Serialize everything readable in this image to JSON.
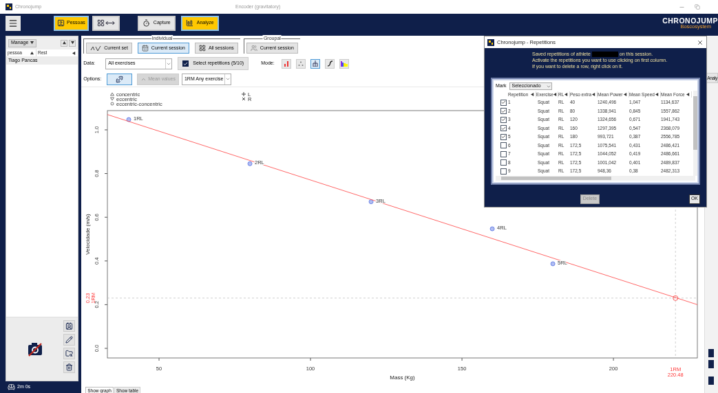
{
  "window": {
    "title": "Chronojump",
    "subtitle": "Encoder (gravitatory)"
  },
  "top_bar": {
    "persons_button": {
      "label": "Pessoas",
      "on": true
    },
    "sections": [
      {
        "kind": "mode",
        "selected": false
      },
      {
        "kind": "capture",
        "label": "Capture",
        "selected": false
      },
      {
        "kind": "analyze",
        "label": "Analyze",
        "selected": true
      }
    ],
    "logo": {
      "title": "CHRONOJUMP",
      "subtitle": "Boscosystem"
    }
  },
  "persons_panel": {
    "manage": "Manage",
    "columns": [
      "pessoa",
      "Rest"
    ],
    "rows": [
      {
        "name": "Tiago Pancas",
        "selected": true
      }
    ],
    "rest_time": "2m 0s"
  },
  "individual": {
    "title": "Individual",
    "buttons": [
      {
        "kind": "set",
        "label": "Current set",
        "selected": false
      },
      {
        "kind": "session",
        "label": "Current session",
        "selected": true
      },
      {
        "kind": "sessions",
        "label": "All sessions",
        "selected": false
      }
    ]
  },
  "groupal": {
    "title": "Groupal",
    "buttons": [
      {
        "kind": "group",
        "label": "Current session",
        "selected": false
      }
    ]
  },
  "data": {
    "label": "Data:",
    "value": "All exercises"
  },
  "select_repetitions": {
    "label": "Select repetitions (5/10)",
    "checked": true
  },
  "mode": {
    "label": "Mode:",
    "options": [
      {
        "kind": "bars",
        "selected": false
      },
      {
        "kind": "scatter",
        "selected": false
      },
      {
        "kind": "boxes",
        "selected": true
      },
      {
        "kind": "curve",
        "selected": false
      },
      {
        "kind": "colors",
        "selected": false
      }
    ]
  },
  "options": {
    "label": "Options:",
    "lift_selected": true,
    "mean_values": {
      "label": "Mean values",
      "disabled": true
    },
    "analysis": "1RM Any exercise"
  },
  "chart": {
    "legend": [
      {
        "kind": "triangle-up",
        "label": "concentric"
      },
      {
        "kind": "triangle-down",
        "label": "eccentric"
      },
      {
        "kind": "circle",
        "label": "eccentric-concentric"
      },
      {
        "kind": "plus",
        "label": "L"
      },
      {
        "kind": "cross",
        "label": "R"
      }
    ],
    "chart_data": {
      "type": "scatter",
      "xlabel": "Mass (Kg)",
      "ylabel": "Velocidade (m/s)",
      "xlim": [
        32.95,
        227.7
      ],
      "ylim": [
        -0.044,
        1.088
      ],
      "xticks": [
        50,
        100,
        150,
        200
      ],
      "yticks": [
        {
          "value": 0,
          "label": "0.0"
        },
        {
          "value": 0.2,
          "label": "0.2"
        },
        {
          "value": 0.4,
          "label": "0.4"
        },
        {
          "value": 0.6,
          "label": "0.6"
        },
        {
          "value": 0.8,
          "label": "0.8"
        },
        {
          "value": 1.0,
          "label": "1.0"
        }
      ],
      "x": [
        40,
        80,
        120,
        160,
        180
      ],
      "series": [
        {
          "type": "scatter",
          "color": "#6f86e8",
          "values": [
            1.047,
            0.845,
            0.671,
            0.547,
            0.387
          ]
        },
        {
          "type": "line",
          "color": "#ff5555",
          "x": [
            32.95,
            227.7
          ],
          "values": [
            1.07,
            0.2
          ]
        }
      ],
      "value_labels": [
        "1RL",
        "2RL",
        "3RL",
        "4RL",
        "5RL"
      ],
      "ref_lines": [
        {
          "axis": "x",
          "value": 220.48
        },
        {
          "axis": "y",
          "value": 0.23
        }
      ],
      "annotations": [
        "1RM",
        "220.48",
        "0.23",
        "1RM"
      ]
    }
  },
  "bottom_tabs": [
    {
      "label": "Show graph",
      "selected": true
    },
    {
      "label": "Show table",
      "selected": false
    }
  ],
  "right_edge_button": "Analy",
  "dialog": {
    "title": "Chronojump - Repetitions",
    "intro_before": "Saved repetitions of athlete",
    "intro_after": "on this session.",
    "intro_lines": [
      "Activate the repetitions you want to use clicking on first column.",
      "If you want to delete a row, right click on it."
    ],
    "mark_label": "Mark",
    "mark_value": "Seleccionado",
    "columns": [
      "Repetition",
      "Exercise",
      "RL",
      "Peso extra",
      "Mean Power",
      "Mean Speed",
      "Mean Force"
    ],
    "rows": [
      {
        "checked": true,
        "cells": [
          "1",
          "Squat",
          "RL",
          "40",
          "1240,496",
          "1,047",
          "1134,637"
        ]
      },
      {
        "checked": true,
        "cells": [
          "2",
          "Squat",
          "RL",
          "80",
          "1338,941",
          "0,845",
          "1557,862"
        ]
      },
      {
        "checked": true,
        "cells": [
          "3",
          "Squat",
          "RL",
          "120",
          "1324,656",
          "0,671",
          "1941,743"
        ]
      },
      {
        "checked": true,
        "cells": [
          "4",
          "Squat",
          "RL",
          "160",
          "1297,395",
          "0,547",
          "2368,079"
        ]
      },
      {
        "checked": true,
        "cells": [
          "5",
          "Squat",
          "RL",
          "180",
          "993,721",
          "0,387",
          "2556,785"
        ]
      },
      {
        "checked": false,
        "cells": [
          "6",
          "Squat",
          "RL",
          "172,5",
          "1075,541",
          "0,431",
          "2486,421"
        ]
      },
      {
        "checked": false,
        "cells": [
          "7",
          "Squat",
          "RL",
          "172,5",
          "1044,052",
          "0,419",
          "2486,661"
        ]
      },
      {
        "checked": false,
        "cells": [
          "8",
          "Squat",
          "RL",
          "172,5",
          "1001,042",
          "0,401",
          "2489,837"
        ]
      },
      {
        "checked": false,
        "cells": [
          "9",
          "Squat",
          "RL",
          "172,5",
          "948,36",
          "0,38",
          "2482,313"
        ]
      }
    ],
    "delete": {
      "label": "Delete",
      "disabled": true
    },
    "ok": "OK"
  }
}
